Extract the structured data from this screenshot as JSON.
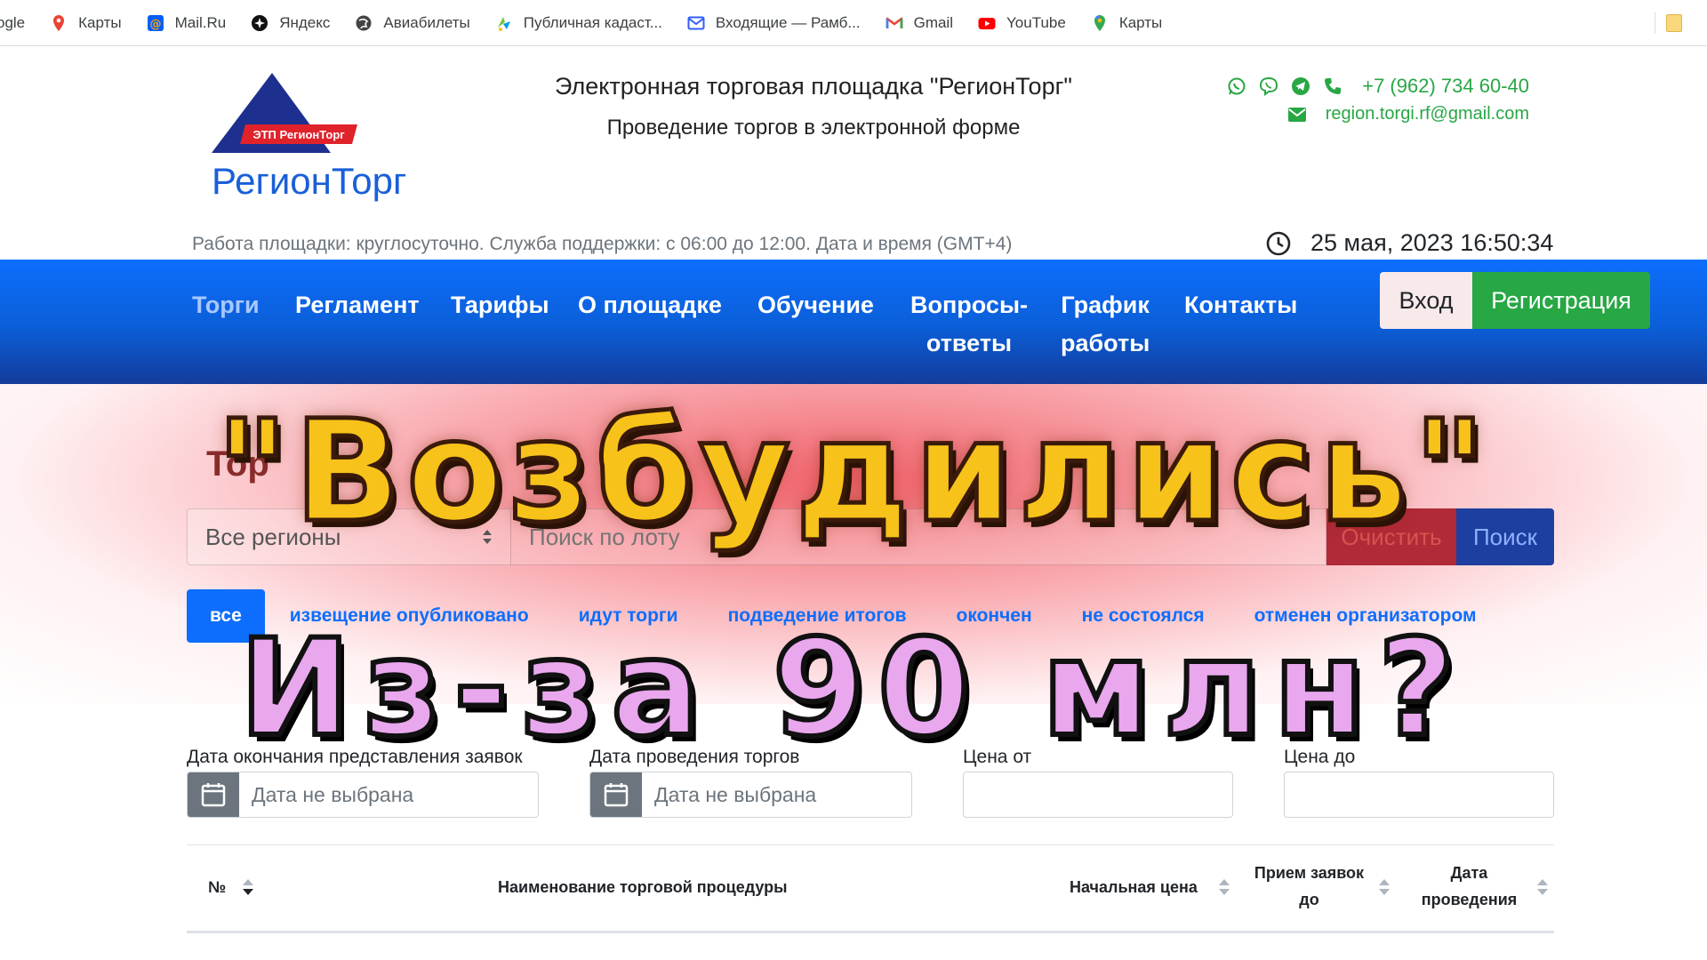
{
  "bookmarks": [
    {
      "label": "ogle",
      "icon": "google-icon"
    },
    {
      "label": "Карты",
      "icon": "map-pin-icon"
    },
    {
      "label": "Mail.Ru",
      "icon": "mailru-icon"
    },
    {
      "label": "Яндекс",
      "icon": "yandex-icon"
    },
    {
      "label": "Авиабилеты",
      "icon": "globe-icon"
    },
    {
      "label": "Публичная кадаст...",
      "icon": "cadastre-icon"
    },
    {
      "label": "Входящие — Рамб...",
      "icon": "inbox-icon"
    },
    {
      "label": "Gmail",
      "icon": "gmail-icon"
    },
    {
      "label": "YouTube",
      "icon": "youtube-icon"
    },
    {
      "label": "Карты",
      "icon": "google-maps-icon"
    }
  ],
  "header": {
    "logo_badge": "ЭТП РегионТорг",
    "logo_text": "РегионТорг",
    "title": "Электронная торговая площадка \"РегионТорг\"",
    "subtitle": "Проведение торгов в электронной форме",
    "phone": "+7 (962) 734 60-40",
    "email": "region.torgi.rf@gmail.com",
    "worktime": "Работа площадки: круглосуточно. Служба поддержки: с 06:00 до 12:00. Дата и время (GMT+4)",
    "datetime": "25 мая, 2023 16:50:34"
  },
  "nav": {
    "items": [
      {
        "l1": "Торги",
        "l2": ""
      },
      {
        "l1": "Регламент",
        "l2": ""
      },
      {
        "l1": "Тарифы",
        "l2": ""
      },
      {
        "l1": "О площадке",
        "l2": ""
      },
      {
        "l1": "Обучение",
        "l2": ""
      },
      {
        "l1": "Вопросы-",
        "l2": "ответы"
      },
      {
        "l1": "График",
        "l2": "работы"
      },
      {
        "l1": "Контакты",
        "l2": ""
      }
    ],
    "login": "Вход",
    "register": "Регистрация"
  },
  "search": {
    "partial_heading": "Тор",
    "region_value": "Все регионы",
    "lot_placeholder": "Поиск по лоту",
    "clear": "Очистить",
    "submit": "Поиск"
  },
  "status_tabs": [
    "все",
    "извещение опубликовано",
    "идут торги",
    "подведение итогов",
    "окончен",
    "не состоялся",
    "отменен организатором"
  ],
  "filters": {
    "end_date_label": "Дата окончания представления заявок",
    "trade_date_label": "Дата проведения торгов",
    "price_from_label": "Цена от",
    "price_to_label": "Цена до",
    "date_placeholder": "Дата не выбрана"
  },
  "table": {
    "col_num": "№",
    "col_name": "Наименование торговой процедуры",
    "col_price": "Начальная цена",
    "col_apps_1": "Прием заявок",
    "col_apps_2": "до",
    "col_date_1": "Дата",
    "col_date_2": "проведения"
  },
  "overlay": {
    "line1": "\"Возбудились\"",
    "line2": "Из-за 90 млн?"
  },
  "colors": {
    "accent": "#0d6efd",
    "success": "#28a745",
    "overlay_gold": "#f7c21a",
    "overlay_pink": "#e9a7ee"
  }
}
